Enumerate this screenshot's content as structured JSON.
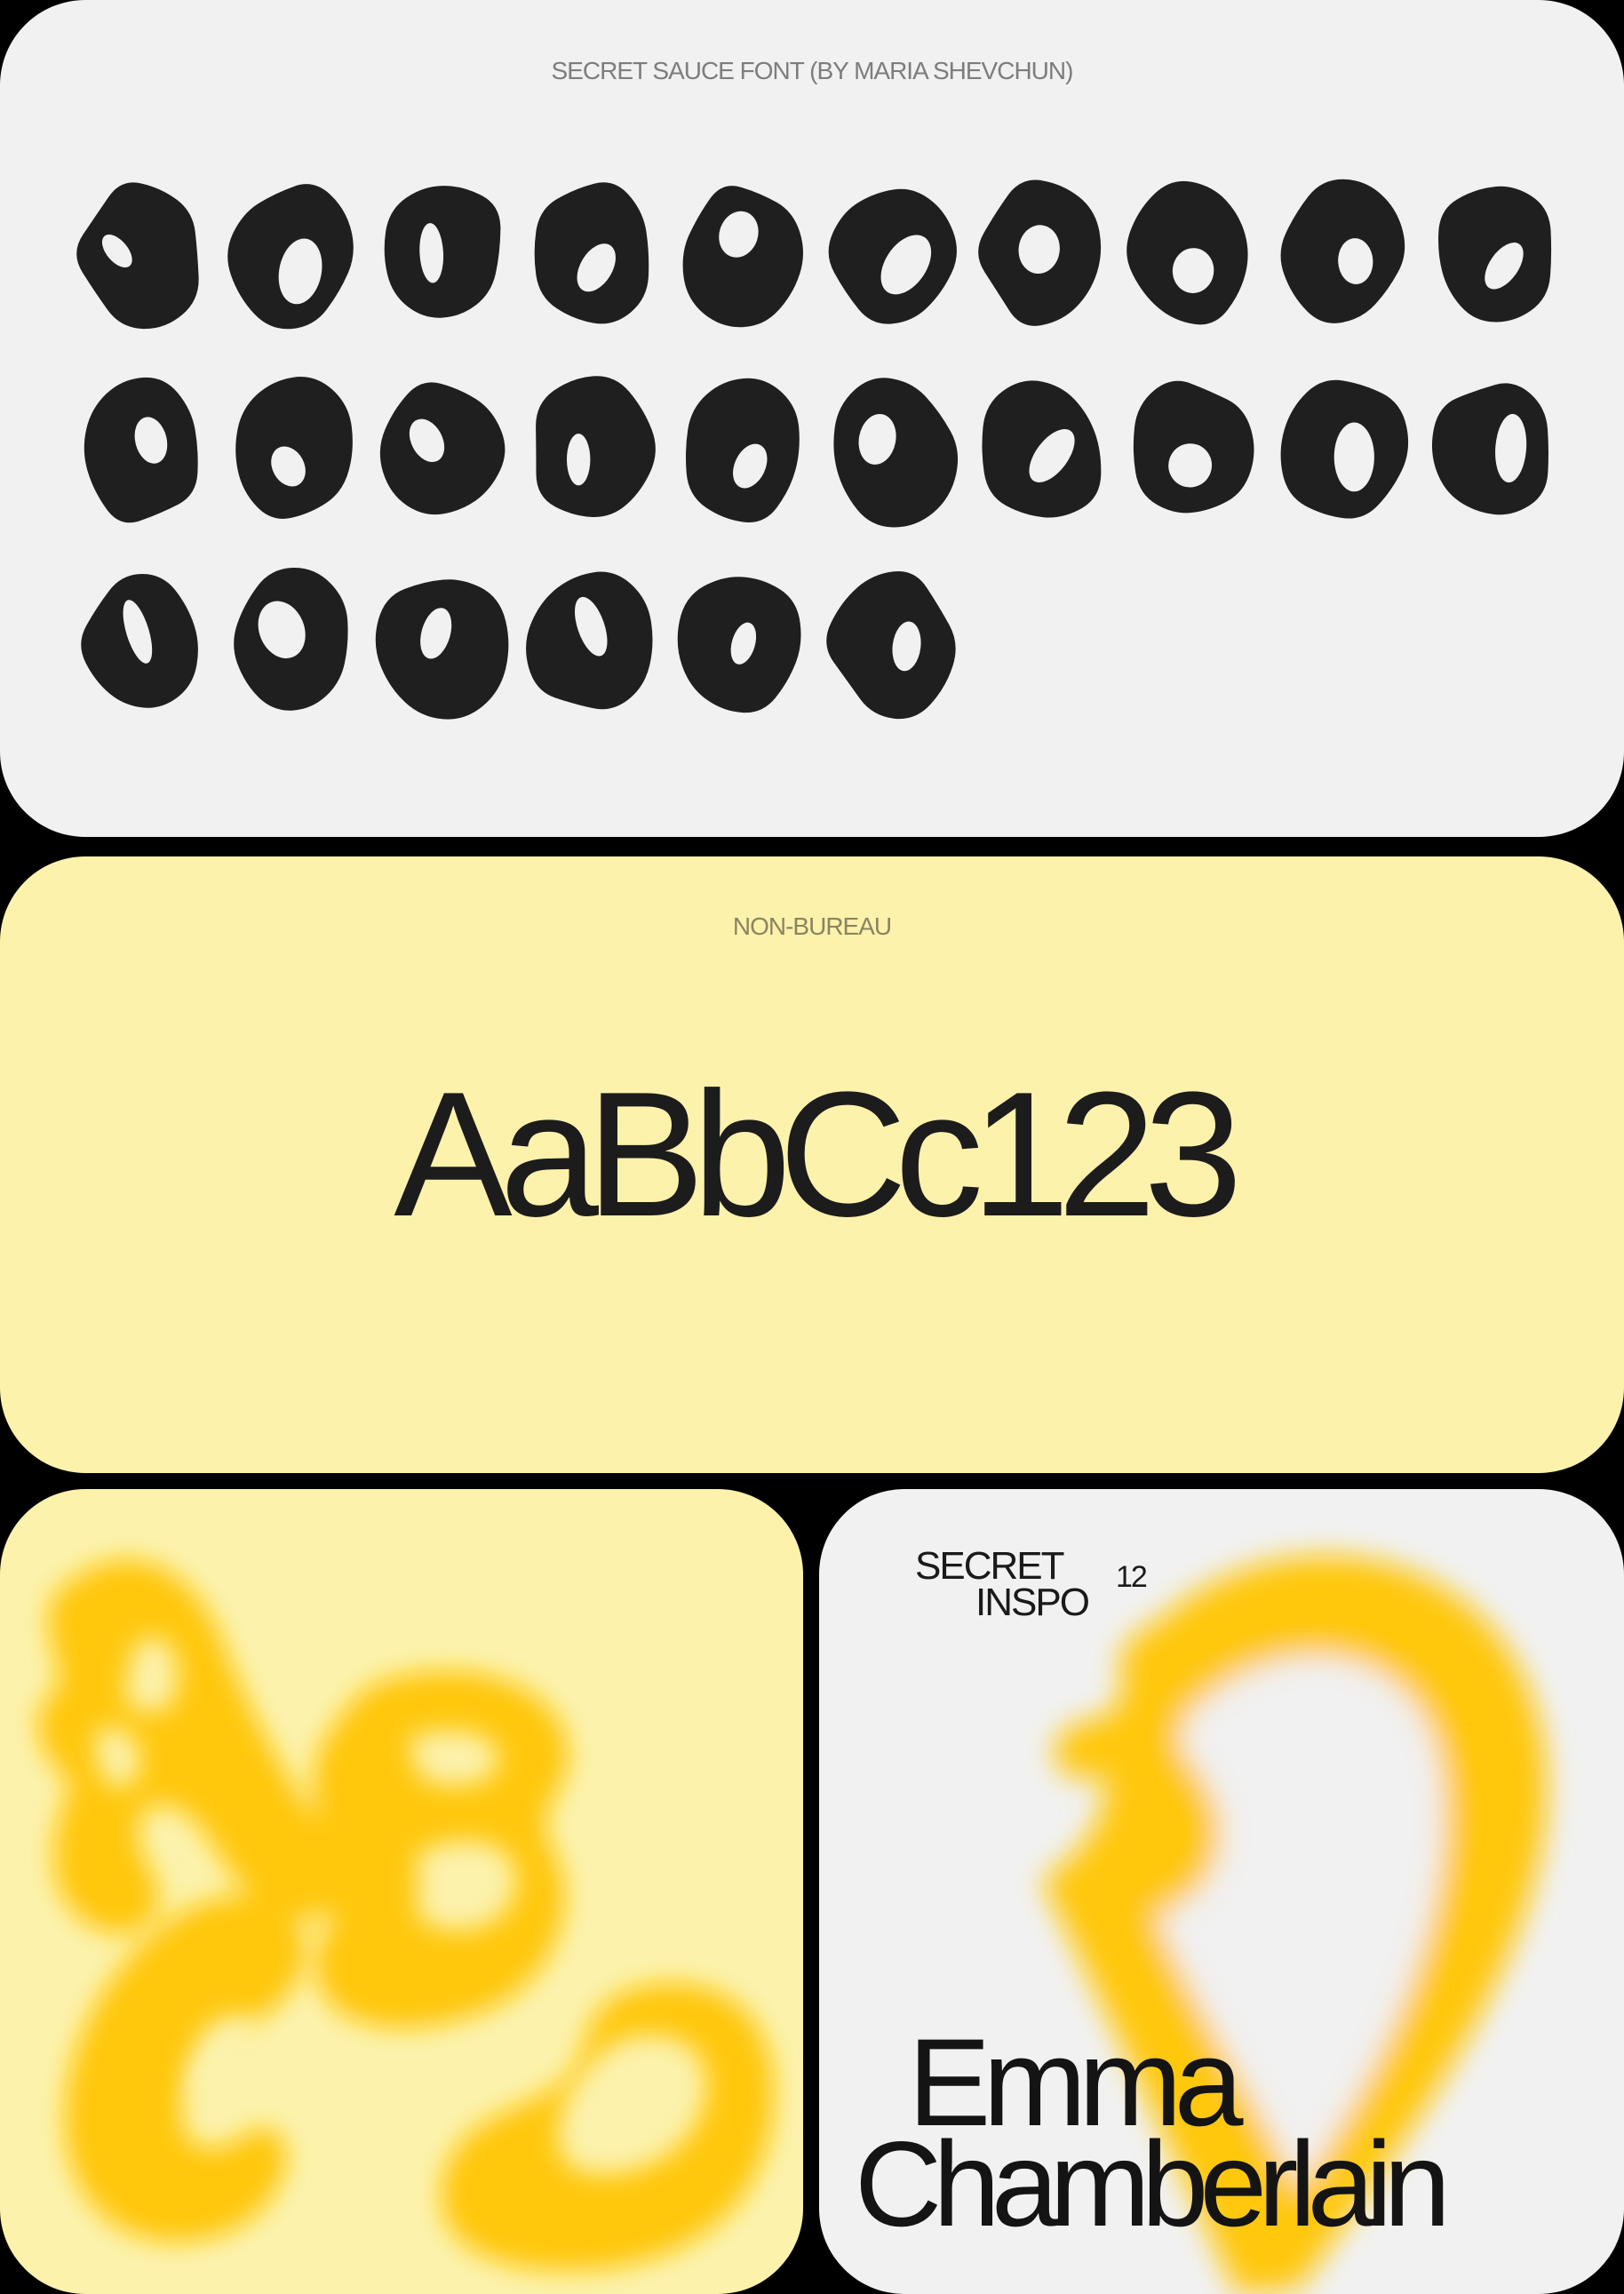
{
  "panel_font_specimen": {
    "caption": "SECRET SAUCE FONT (BY MARIA SHEVCHUN)",
    "glyphs": [
      "A",
      "B",
      "C",
      "D",
      "E",
      "F",
      "G",
      "H",
      "I",
      "J",
      "K",
      "L",
      "M",
      "N",
      "O",
      "P",
      "Q",
      "R",
      "S",
      "T",
      "U",
      "V",
      "W",
      "X",
      "Y",
      "Z"
    ],
    "glyph_color": "#1f1f1f",
    "background": "#f1f1f1"
  },
  "panel_type_sample": {
    "caption": "NON-BUREAU",
    "sample_text": "AaBbCc123",
    "background": "#fcf2ac"
  },
  "panel_blobs": {
    "glyphs": [
      "A",
      "B",
      "C",
      "D"
    ],
    "glyph_color": "#ffc80d",
    "background": "#fcf2ac"
  },
  "panel_poster": {
    "title_line1": "SECRET",
    "title_line2": "INSPO",
    "issue_number": "12",
    "name_first": "Emma",
    "name_last": "Chamberlain",
    "glyph": "D",
    "glyph_color": "#ffc80d",
    "background": "#f1f1f1"
  }
}
